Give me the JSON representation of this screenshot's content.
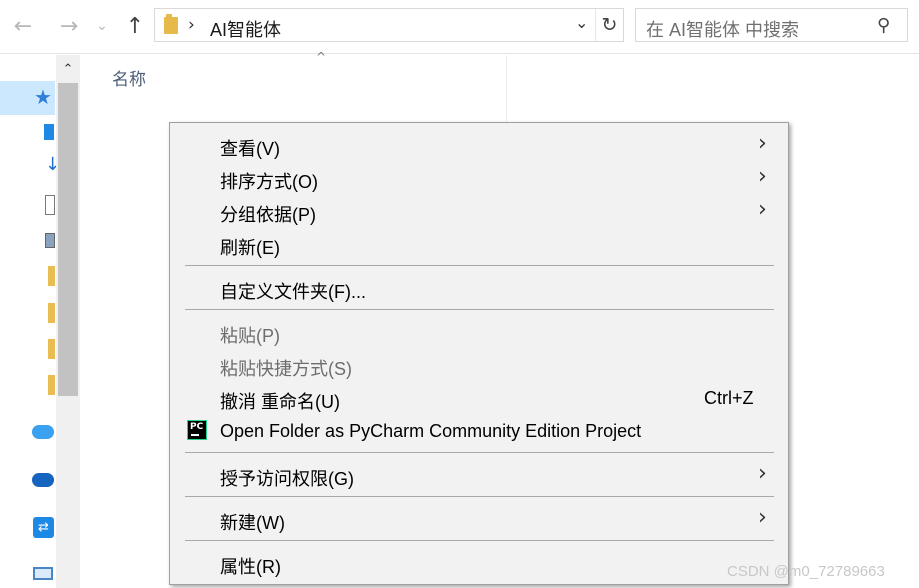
{
  "toolbar": {
    "back_glyph": "←",
    "forward_glyph": "→",
    "recent_glyph": "⌄",
    "up_glyph": "↑",
    "address_sep": "›",
    "address_text": "AI智能体",
    "address_dropdown_glyph": "⌄",
    "refresh_glyph": "↻",
    "search_placeholder": "在 AI智能体 中搜索",
    "search_glyph": "⚲"
  },
  "nav_pane": {
    "scroll_up_glyph": "⌃",
    "quick_access_glyph": "★",
    "download_glyph": "↓",
    "app_glyph": "⇄",
    "icons": [
      "pin-star-icon",
      "desktop-icon",
      "download-icon",
      "document-icon",
      "picture-icon",
      "folder-icon",
      "folder-icon",
      "folder-icon",
      "folder-icon",
      "icloud-icon",
      "onedrive-icon",
      "app-icon",
      "this-pc-icon"
    ]
  },
  "file_list": {
    "name_column": "名称",
    "sort_glyph": "^"
  },
  "context_menu": {
    "submenu_glyph": "›",
    "pycharm_icon_text": "PC",
    "items": [
      {
        "label": "查看(V)"
      },
      {
        "label": "排序方式(O)"
      },
      {
        "label": "分组依据(P)"
      },
      {
        "label": "刷新(E)"
      },
      {
        "label": "自定义文件夹(F)..."
      },
      {
        "label": "粘贴(P)"
      },
      {
        "label": "粘贴快捷方式(S)"
      },
      {
        "label": "撤消 重命名(U)",
        "shortcut": "Ctrl+Z"
      },
      {
        "label": "Open Folder as PyCharm Community Edition Project"
      },
      {
        "label": "授予访问权限(G)"
      },
      {
        "label": "新建(W)"
      },
      {
        "label": "属性(R)"
      }
    ]
  },
  "watermark": "CSDN @m0_72789663",
  "colors": {
    "menu_bg": "#f2f2f2",
    "selection": "#cce8ff",
    "disabled_text": "#6d6d6d",
    "accent": "#2f7ed8"
  }
}
